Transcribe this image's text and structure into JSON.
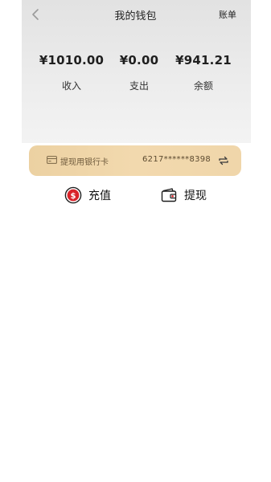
{
  "header": {
    "title": "我的钱包",
    "bill_label": "账单",
    "back_icon": "chevron-left-icon"
  },
  "stats": [
    {
      "amount": "¥1010.00",
      "label": "收入"
    },
    {
      "amount": "¥0.00",
      "label": "支出"
    },
    {
      "amount": "¥941.21",
      "label": "余额"
    }
  ],
  "bank_card": {
    "label": "提现用银行卡",
    "number": "6217******8398",
    "card_icon": "credit-card-icon",
    "swap_icon": "swap-icon"
  },
  "actions": {
    "recharge_label": "充值",
    "recharge_icon": "dollar-coin-icon",
    "withdraw_label": "提现",
    "withdraw_icon": "wallet-icon"
  },
  "colors": {
    "accent_red": "#d9232a",
    "card_gold": "#f0d6aa"
  }
}
